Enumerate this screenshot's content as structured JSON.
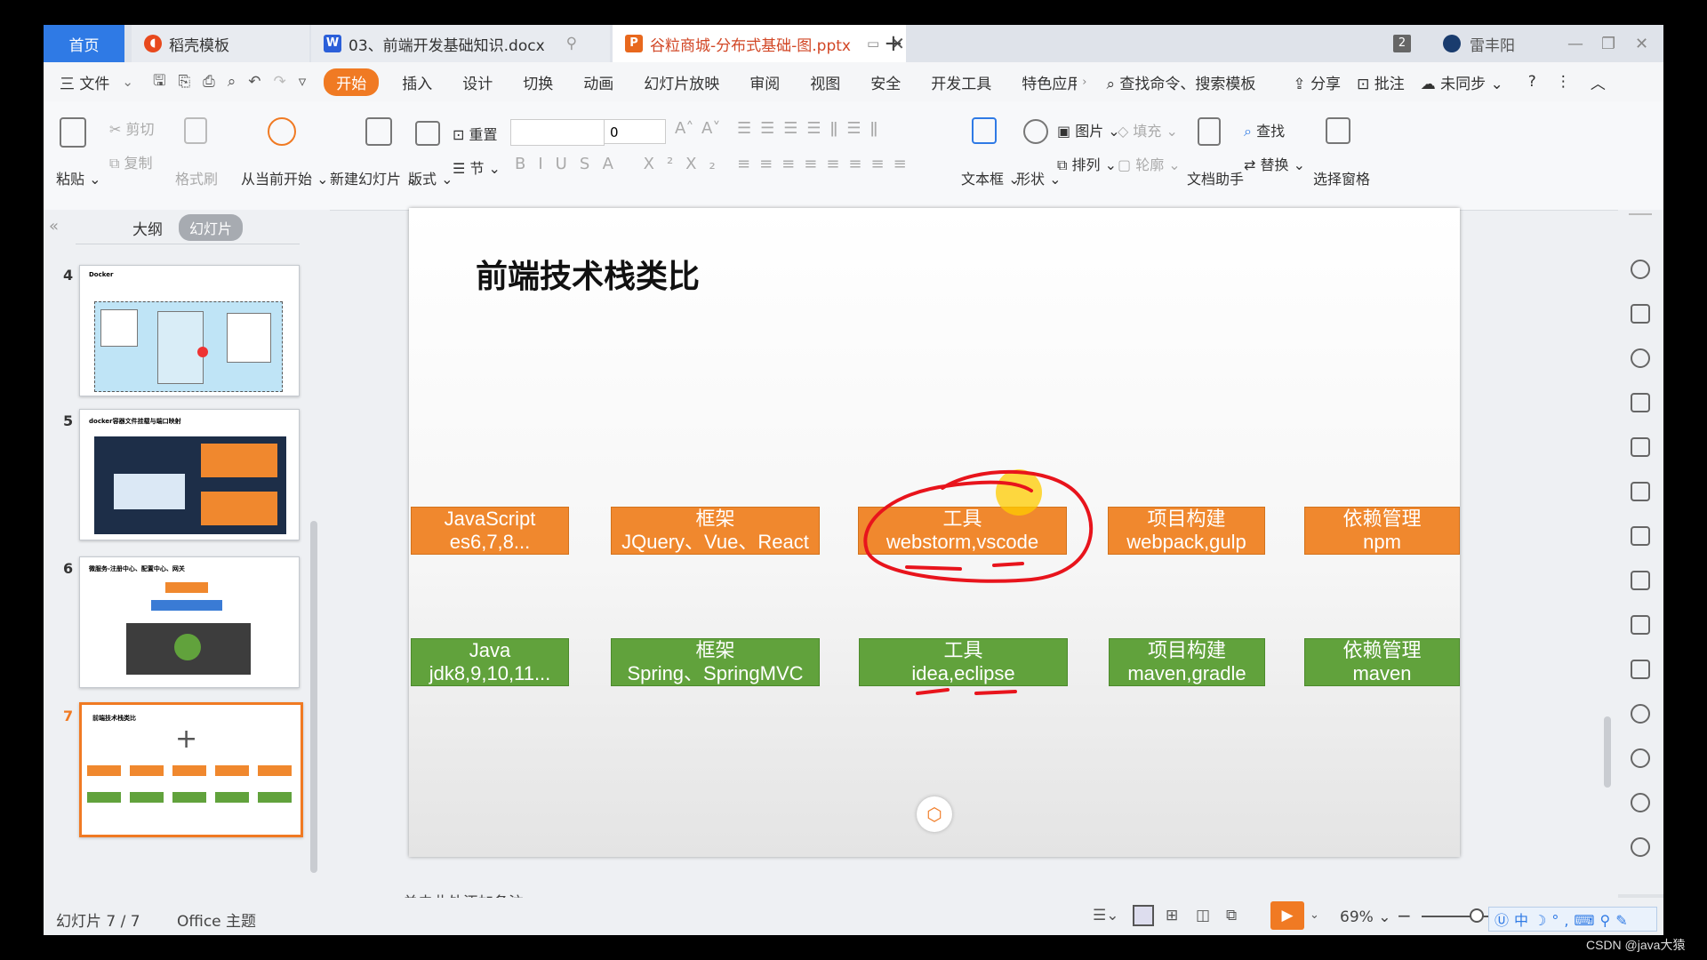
{
  "tabs": {
    "home": "首页",
    "template": "稻壳模板",
    "doc": "03、前端开发基础知识.docx",
    "ppt": "谷粒商城-分布式基础-图.pptx",
    "add": "+"
  },
  "titlebar_right": {
    "badge": "2",
    "user": "雷丰阳"
  },
  "menu": {
    "file": "三 文件",
    "items": [
      "开始",
      "插入",
      "设计",
      "切换",
      "动画",
      "幻灯片放映",
      "审阅",
      "视图",
      "安全",
      "开发工具",
      "特色应用"
    ],
    "search": "查找命令、搜索模板",
    "share": "分享",
    "comment": "批注",
    "sync": "未同步"
  },
  "ribbon": {
    "paste": "粘贴",
    "cut": "剪切",
    "copy": "复制",
    "format_painter": "格式刷",
    "play_from_current": "从当前开始",
    "new_slide": "新建幻灯片",
    "layout": "版式",
    "reset": "重置",
    "section": "节",
    "font_size": "0",
    "textbox": "文本框",
    "shape": "形状",
    "picture": "图片",
    "arrange": "排列",
    "fill": "填充",
    "outline": "轮廓",
    "doc_assistant": "文档助手",
    "find": "查找",
    "replace": "替换",
    "select_pane": "选择窗格"
  },
  "left_panel": {
    "outline": "大纲",
    "slides": "幻灯片",
    "add": "+",
    "thumbs": [
      {
        "num": "4",
        "title": "Docker"
      },
      {
        "num": "5",
        "title": "docker容器文件挂载与端口映射"
      },
      {
        "num": "6",
        "title": "微服务-注册中心、配置中心、网关"
      },
      {
        "num": "7",
        "title": "前端技术栈类比"
      }
    ]
  },
  "slide": {
    "title": "前端技术栈类比",
    "row_frontend": [
      {
        "line1": "JavaScript",
        "line2": "es6,7,8..."
      },
      {
        "line1": "框架",
        "line2": "JQuery、Vue、React"
      },
      {
        "line1": "工具",
        "line2": "webstorm,vscode"
      },
      {
        "line1": "项目构建",
        "line2": "webpack,gulp"
      },
      {
        "line1": "依赖管理",
        "line2": "npm"
      }
    ],
    "row_backend": [
      {
        "line1": "Java",
        "line2": "jdk8,9,10,11..."
      },
      {
        "line1": "框架",
        "line2": "Spring、SpringMVC"
      },
      {
        "line1": "工具",
        "line2": "idea,eclipse"
      },
      {
        "line1": "项目构建",
        "line2": "maven,gradle"
      },
      {
        "line1": "依赖管理",
        "line2": "maven"
      }
    ]
  },
  "notes": "单击此处添加备注",
  "status": {
    "slide_counter": "幻灯片 7 / 7",
    "theme": "Office 主题",
    "zoom": "69%"
  },
  "watermark": "CSDN @java大猿",
  "colors": {
    "accent": "#f07a23",
    "orange_box": "#f0882e",
    "green_box": "#61a23c",
    "annotation": "#e8141c",
    "home_tab": "#2f7ae5"
  }
}
